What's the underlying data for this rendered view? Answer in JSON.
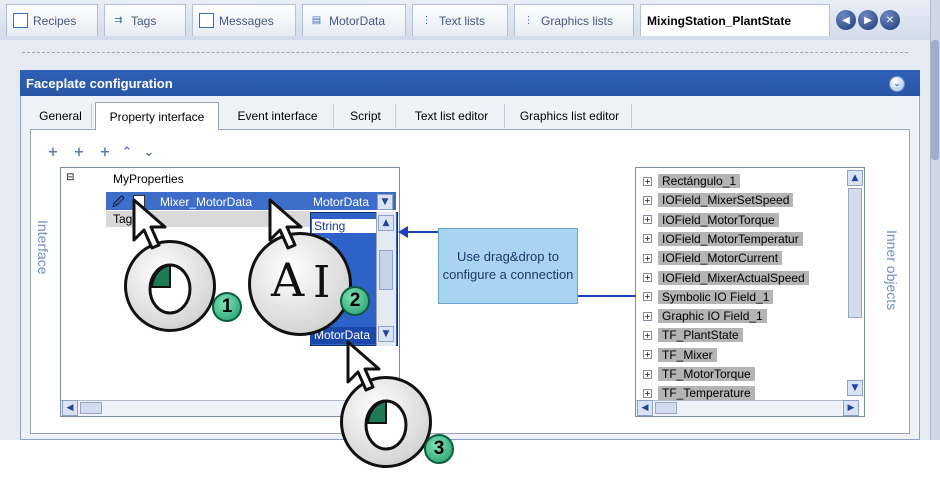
{
  "editor_tabs": [
    {
      "label": "Recipes",
      "icon": "recipes-icon"
    },
    {
      "label": "Tags",
      "icon": "tags-icon"
    },
    {
      "label": "Messages",
      "icon": "messages-icon"
    },
    {
      "label": "MotorData",
      "icon": "datatype-icon"
    },
    {
      "label": "Text lists",
      "icon": "textlist-icon"
    },
    {
      "label": "Graphics lists",
      "icon": "graphicslist-icon"
    },
    {
      "label": "MixingStation_PlantState",
      "icon": ""
    }
  ],
  "panel": {
    "title": "Faceplate configuration",
    "tabs": [
      "General",
      "Property interface",
      "Event interface",
      "Script",
      "Text list editor",
      "Graphics list editor"
    ],
    "active_tab": "Property interface"
  },
  "interface": {
    "label": "Interface",
    "root": "MyProperties",
    "row_name": "Mixer_MotorData",
    "row_type": "MotorData",
    "row2": "Tags",
    "dropdown_options": [
      "String",
      "ble",
      "MotorData"
    ]
  },
  "inner_objects": {
    "label": "Inner objects",
    "items": [
      "Rectángulo_1",
      "IOField_MixerSetSpeed",
      "IOField_MotorTorque",
      "IOField_MotorTemperatur",
      "IOField_MotorCurrent",
      "IOField_MixerActualSpeed",
      "Symbolic IO Field_1",
      "Graphic IO Field_1",
      "TF_PlantState",
      "TF_Mixer",
      "TF_MotorTorque",
      "TF_Temperature"
    ]
  },
  "callout": {
    "text": "Use drag&drop to configure a connection"
  },
  "badges": [
    "1",
    "2",
    "3"
  ],
  "colors": {
    "title_bar": "#2f61b8",
    "callout": "#a8d4f2",
    "arrow": "#1f3fbf",
    "badge": "#2dbb85",
    "selection": "#2d63c8"
  }
}
